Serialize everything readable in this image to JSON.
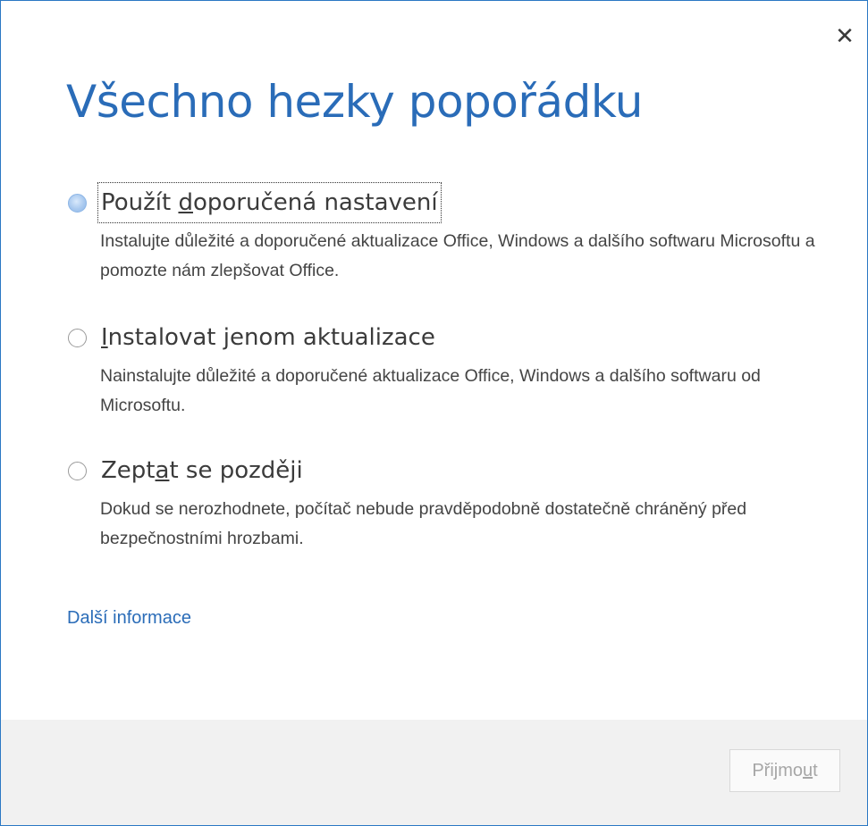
{
  "dialog": {
    "close_glyph": "✕",
    "title": "Všechno hezky popořádku"
  },
  "options": [
    {
      "label_pre": "Použít ",
      "label_accel": "d",
      "label_post": "oporučená nastavení",
      "description": "Instalujte důležité a doporučené aktualizace Office, Windows a dalšího softwaru Microsoftu a pomozte nám zlepšovat Office.",
      "selected": true
    },
    {
      "label_pre": "",
      "label_accel": "I",
      "label_post": "nstalovat jenom aktualizace",
      "description": "Nainstalujte důležité a doporučené aktualizace Office, Windows a dalšího softwaru od Microsoftu.",
      "selected": false
    },
    {
      "label_pre": "Zept",
      "label_accel": "a",
      "label_post": "t se později",
      "description": "Dokud se nerozhodnete, počítač nebude pravděpodobně dostatečně chráněný před bezpečnostními hrozbami.",
      "selected": false
    }
  ],
  "more_info_link": "Další informace",
  "accept_button": {
    "label_pre": "Přijmo",
    "label_accel": "u",
    "label_post": "t",
    "enabled": false
  },
  "colors": {
    "accent": "#2a6cb8",
    "border": "#2b78c4",
    "footer_bg": "#f1f1f1"
  }
}
